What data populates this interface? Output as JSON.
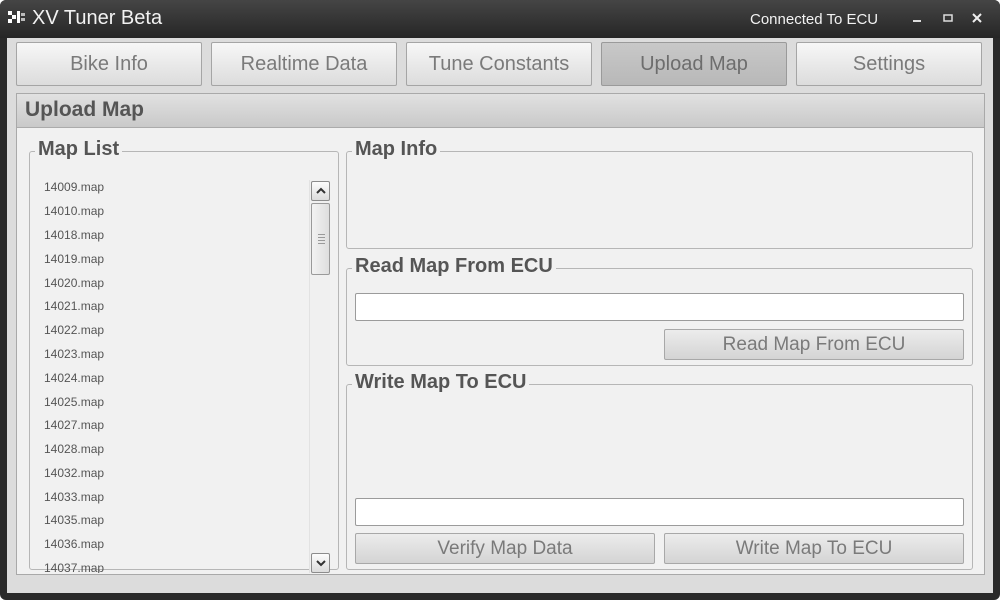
{
  "window": {
    "title": "XV Tuner Beta",
    "connection_status": "Connected To ECU",
    "icon": "app-logo-icon",
    "controls": [
      "minimize-icon",
      "maximize-icon",
      "close-icon"
    ]
  },
  "tabs": [
    {
      "label": "Bike Info",
      "active": false
    },
    {
      "label": "Realtime Data",
      "active": false
    },
    {
      "label": "Tune Constants",
      "active": false
    },
    {
      "label": "Upload Map",
      "active": true
    },
    {
      "label": "Settings",
      "active": false
    }
  ],
  "panel": {
    "title": "Upload Map",
    "map_list": {
      "legend": "Map List",
      "items": [
        "14009.map",
        "14010.map",
        "14018.map",
        "14019.map",
        "14020.map",
        "14021.map",
        "14022.map",
        "14023.map",
        "14024.map",
        "14025.map",
        "14027.map",
        "14028.map",
        "14032.map",
        "14033.map",
        "14035.map",
        "14036.map",
        "14037.map"
      ]
    },
    "map_info": {
      "legend": "Map Info"
    },
    "read_section": {
      "legend": "Read Map From ECU",
      "input_value": "",
      "button_label": "Read Map From ECU"
    },
    "write_section": {
      "legend": "Write Map To ECU",
      "input_value": "",
      "verify_button_label": "Verify Map Data",
      "write_button_label": "Write Map To ECU"
    }
  },
  "colors": {
    "titlebar": "#2a2a2a",
    "client_background": "#dcdcdc",
    "panel_background": "#f1f1f1",
    "active_tab": "#c0c0c0",
    "text": "#555555"
  }
}
